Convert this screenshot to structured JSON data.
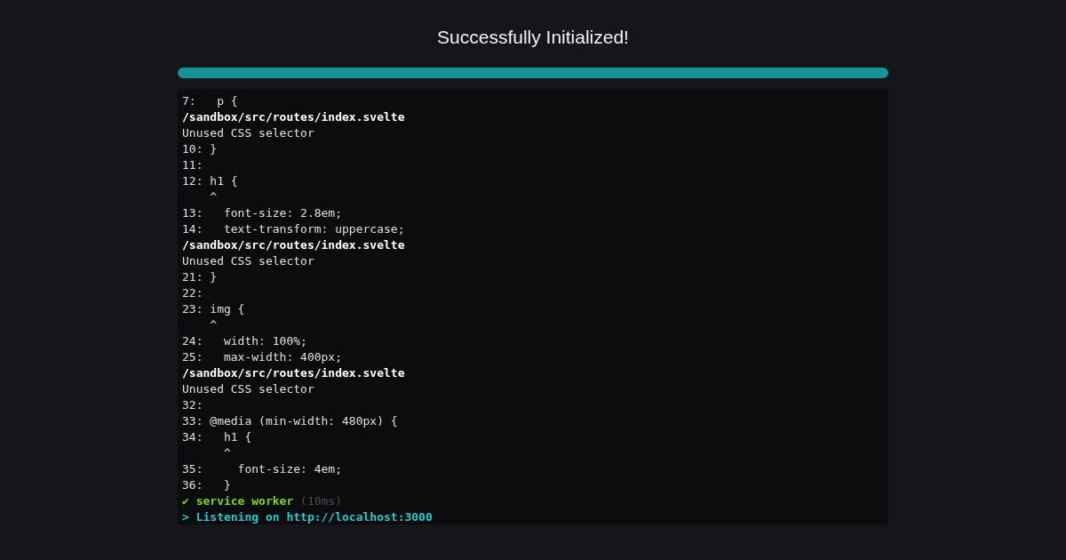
{
  "title": "Successfully Initialized!",
  "progress": {
    "level": 1
  },
  "log": [
    {
      "kind": "plain",
      "text": "7:   p {"
    },
    {
      "kind": "path",
      "text": "/sandbox/src/routes/index.svelte"
    },
    {
      "kind": "plain",
      "text": "Unused CSS selector"
    },
    {
      "kind": "plain",
      "text": "10: }"
    },
    {
      "kind": "plain",
      "text": "11:"
    },
    {
      "kind": "plain",
      "text": "12: h1 {"
    },
    {
      "kind": "plain",
      "text": "    ^"
    },
    {
      "kind": "plain",
      "text": "13:   font-size: 2.8em;"
    },
    {
      "kind": "plain",
      "text": "14:   text-transform: uppercase;"
    },
    {
      "kind": "path",
      "text": "/sandbox/src/routes/index.svelte"
    },
    {
      "kind": "plain",
      "text": "Unused CSS selector"
    },
    {
      "kind": "plain",
      "text": "21: }"
    },
    {
      "kind": "plain",
      "text": "22:"
    },
    {
      "kind": "plain",
      "text": "23: img {"
    },
    {
      "kind": "plain",
      "text": "    ^"
    },
    {
      "kind": "plain",
      "text": "24:   width: 100%;"
    },
    {
      "kind": "plain",
      "text": "25:   max-width: 400px;"
    },
    {
      "kind": "path",
      "text": "/sandbox/src/routes/index.svelte"
    },
    {
      "kind": "plain",
      "text": "Unused CSS selector"
    },
    {
      "kind": "plain",
      "text": "32:"
    },
    {
      "kind": "plain",
      "text": "33: @media (min-width: 480px) {"
    },
    {
      "kind": "plain",
      "text": "34:   h1 {"
    },
    {
      "kind": "plain",
      "text": "      ^"
    },
    {
      "kind": "plain",
      "text": "35:     font-size: 4em;"
    },
    {
      "kind": "plain",
      "text": "36:   }"
    },
    {
      "kind": "success",
      "mark": "✔",
      "text": "service worker",
      "timing": "(10ms)"
    },
    {
      "kind": "info",
      "text": "> Listening on http://localhost:3000"
    }
  ]
}
